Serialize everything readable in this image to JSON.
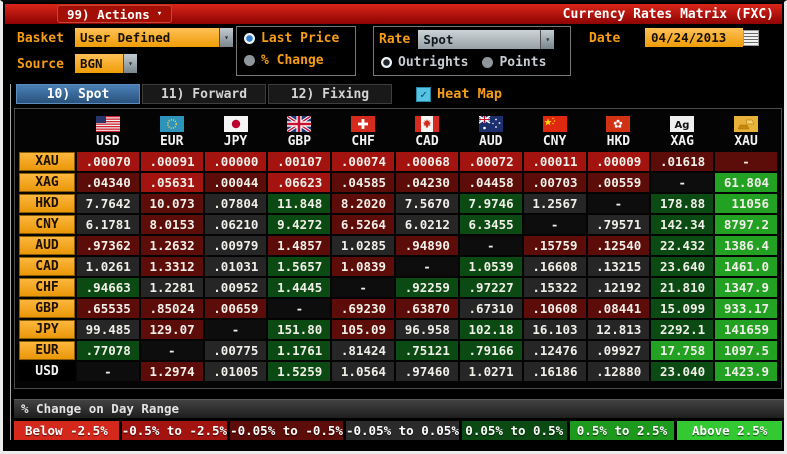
{
  "titlebar": {
    "menu": "99) Actions",
    "title": "Currency Rates Matrix (FXC)"
  },
  "controls": {
    "basket_label": "Basket",
    "basket_value": "User Defined",
    "source_label": "Source",
    "source_value": "BGN",
    "price_mode": [
      {
        "label": "Last Price",
        "selected": true
      },
      {
        "label": "% Change",
        "selected": false
      }
    ],
    "rate_label": "Rate",
    "rate_value": "Spot",
    "rate_mode": [
      {
        "label": "Outrights",
        "selected": true
      },
      {
        "label": "Points",
        "selected": false
      }
    ],
    "date_label": "Date",
    "date_value": "04/24/2013"
  },
  "tabs": [
    {
      "label": "10) Spot",
      "active": true
    },
    {
      "label": "11) Forward",
      "active": false
    },
    {
      "label": "12) Fixing",
      "active": false
    }
  ],
  "heat_map": {
    "label": "Heat Map",
    "checked": true
  },
  "matrix": {
    "columns": [
      {
        "code": "USD",
        "flag": "us"
      },
      {
        "code": "EUR",
        "flag": "eu"
      },
      {
        "code": "JPY",
        "flag": "jp"
      },
      {
        "code": "GBP",
        "flag": "gb"
      },
      {
        "code": "CHF",
        "flag": "ch"
      },
      {
        "code": "CAD",
        "flag": "ca"
      },
      {
        "code": "AUD",
        "flag": "au"
      },
      {
        "code": "CNY",
        "flag": "cn"
      },
      {
        "code": "HKD",
        "flag": "hk"
      },
      {
        "code": "XAG",
        "flag": "ag"
      },
      {
        "code": "XAU",
        "flag": "xau"
      }
    ],
    "rows": [
      {
        "label": "XAU",
        "cells": [
          {
            "v": ".00070",
            "c": "r2"
          },
          {
            "v": ".00091",
            "c": "r2"
          },
          {
            "v": ".00000",
            "c": "r2"
          },
          {
            "v": ".00107",
            "c": "r2"
          },
          {
            "v": ".00074",
            "c": "r2"
          },
          {
            "v": ".00068",
            "c": "r2"
          },
          {
            "v": ".00072",
            "c": "r2"
          },
          {
            "v": ".00011",
            "c": "r2"
          },
          {
            "v": ".00009",
            "c": "r2"
          },
          {
            "v": ".01618",
            "c": "r1"
          },
          {
            "v": "-",
            "c": "r1"
          }
        ]
      },
      {
        "label": "XAG",
        "cells": [
          {
            "v": ".04340",
            "c": "r1"
          },
          {
            "v": ".05631",
            "c": "r2"
          },
          {
            "v": ".00044",
            "c": "r1"
          },
          {
            "v": ".06623",
            "c": "r2"
          },
          {
            "v": ".04585",
            "c": "r1"
          },
          {
            "v": ".04230",
            "c": "r1"
          },
          {
            "v": ".04458",
            "c": "r1"
          },
          {
            "v": ".00703",
            "c": "r1"
          },
          {
            "v": ".00559",
            "c": "r1"
          },
          {
            "v": "-",
            "c": "blk"
          },
          {
            "v": "61.804",
            "c": "g2"
          }
        ]
      },
      {
        "label": "HKD",
        "cells": [
          {
            "v": "7.7642",
            "c": "n0"
          },
          {
            "v": "10.073",
            "c": "r1"
          },
          {
            "v": ".07804",
            "c": "n0"
          },
          {
            "v": "11.848",
            "c": "g1"
          },
          {
            "v": "8.2020",
            "c": "r1"
          },
          {
            "v": "7.5670",
            "c": "n0"
          },
          {
            "v": "7.9746",
            "c": "g1"
          },
          {
            "v": "1.2567",
            "c": "n0"
          },
          {
            "v": "-",
            "c": "blk"
          },
          {
            "v": "178.88",
            "c": "g1"
          },
          {
            "v": "11056",
            "c": "g2"
          }
        ]
      },
      {
        "label": "CNY",
        "cells": [
          {
            "v": "6.1781",
            "c": "n0"
          },
          {
            "v": "8.0153",
            "c": "r1"
          },
          {
            "v": ".06210",
            "c": "n0"
          },
          {
            "v": "9.4272",
            "c": "g1"
          },
          {
            "v": "6.5264",
            "c": "r1"
          },
          {
            "v": "6.0212",
            "c": "n0"
          },
          {
            "v": "6.3455",
            "c": "g1"
          },
          {
            "v": "-",
            "c": "blk"
          },
          {
            "v": ".79571",
            "c": "n0"
          },
          {
            "v": "142.34",
            "c": "g1"
          },
          {
            "v": "8797.2",
            "c": "g2"
          }
        ]
      },
      {
        "label": "AUD",
        "cells": [
          {
            "v": ".97362",
            "c": "r1"
          },
          {
            "v": "1.2632",
            "c": "r1"
          },
          {
            "v": ".00979",
            "c": "n0"
          },
          {
            "v": "1.4857",
            "c": "r1"
          },
          {
            "v": "1.0285",
            "c": "n0"
          },
          {
            "v": ".94890",
            "c": "r1"
          },
          {
            "v": "-",
            "c": "blk"
          },
          {
            "v": ".15759",
            "c": "r1"
          },
          {
            "v": ".12540",
            "c": "r1"
          },
          {
            "v": "22.432",
            "c": "g1"
          },
          {
            "v": "1386.4",
            "c": "g2"
          }
        ]
      },
      {
        "label": "CAD",
        "cells": [
          {
            "v": "1.0261",
            "c": "n0"
          },
          {
            "v": "1.3312",
            "c": "r1"
          },
          {
            "v": ".01031",
            "c": "n0"
          },
          {
            "v": "1.5657",
            "c": "g1"
          },
          {
            "v": "1.0839",
            "c": "r1"
          },
          {
            "v": "-",
            "c": "blk"
          },
          {
            "v": "1.0539",
            "c": "g1"
          },
          {
            "v": ".16608",
            "c": "n0"
          },
          {
            "v": ".13215",
            "c": "n0"
          },
          {
            "v": "23.640",
            "c": "g1"
          },
          {
            "v": "1461.0",
            "c": "g2"
          }
        ]
      },
      {
        "label": "CHF",
        "cells": [
          {
            "v": ".94663",
            "c": "g1"
          },
          {
            "v": "1.2281",
            "c": "n0"
          },
          {
            "v": ".00952",
            "c": "n0"
          },
          {
            "v": "1.4445",
            "c": "g1"
          },
          {
            "v": "-",
            "c": "blk"
          },
          {
            "v": ".92259",
            "c": "g1"
          },
          {
            "v": ".97227",
            "c": "g1"
          },
          {
            "v": ".15322",
            "c": "n0"
          },
          {
            "v": ".12192",
            "c": "n0"
          },
          {
            "v": "21.810",
            "c": "g1"
          },
          {
            "v": "1347.9",
            "c": "g2"
          }
        ]
      },
      {
        "label": "GBP",
        "cells": [
          {
            "v": ".65535",
            "c": "r1"
          },
          {
            "v": ".85024",
            "c": "r1"
          },
          {
            "v": ".00659",
            "c": "r1"
          },
          {
            "v": "-",
            "c": "blk"
          },
          {
            "v": ".69230",
            "c": "r1"
          },
          {
            "v": ".63870",
            "c": "r1"
          },
          {
            "v": ".67310",
            "c": "n0"
          },
          {
            "v": ".10608",
            "c": "r1"
          },
          {
            "v": ".08441",
            "c": "r1"
          },
          {
            "v": "15.099",
            "c": "g1"
          },
          {
            "v": "933.17",
            "c": "g2"
          }
        ]
      },
      {
        "label": "JPY",
        "cells": [
          {
            "v": "99.485",
            "c": "n0"
          },
          {
            "v": "129.07",
            "c": "r1"
          },
          {
            "v": "-",
            "c": "blk"
          },
          {
            "v": "151.80",
            "c": "g1"
          },
          {
            "v": "105.09",
            "c": "r1"
          },
          {
            "v": "96.958",
            "c": "n0"
          },
          {
            "v": "102.18",
            "c": "g1"
          },
          {
            "v": "16.103",
            "c": "n0"
          },
          {
            "v": "12.813",
            "c": "n0"
          },
          {
            "v": "2292.1",
            "c": "g1"
          },
          {
            "v": "141659",
            "c": "g2"
          }
        ]
      },
      {
        "label": "EUR",
        "cells": [
          {
            "v": ".77078",
            "c": "g1"
          },
          {
            "v": "-",
            "c": "blk"
          },
          {
            "v": ".00775",
            "c": "n0"
          },
          {
            "v": "1.1761",
            "c": "g1"
          },
          {
            "v": ".81424",
            "c": "n0"
          },
          {
            "v": ".75121",
            "c": "g1"
          },
          {
            "v": ".79166",
            "c": "g1"
          },
          {
            "v": ".12476",
            "c": "n0"
          },
          {
            "v": ".09927",
            "c": "n0"
          },
          {
            "v": "17.758",
            "c": "g2"
          },
          {
            "v": "1097.5",
            "c": "g2"
          }
        ]
      },
      {
        "label": "USD",
        "header_style": "plain",
        "cells": [
          {
            "v": "-",
            "c": "blk"
          },
          {
            "v": "1.2974",
            "c": "r1"
          },
          {
            "v": ".01005",
            "c": "n0"
          },
          {
            "v": "1.5259",
            "c": "g1"
          },
          {
            "v": "1.0564",
            "c": "n0"
          },
          {
            "v": ".97460",
            "c": "n0"
          },
          {
            "v": "1.0271",
            "c": "n0"
          },
          {
            "v": ".16186",
            "c": "n0"
          },
          {
            "v": ".12880",
            "c": "n0"
          },
          {
            "v": "23.040",
            "c": "g1"
          },
          {
            "v": "1423.9",
            "c": "g2"
          }
        ]
      }
    ]
  },
  "heat_colors": {
    "r2": "#a31411",
    "r1": "#5c0c09",
    "n0": "#262626",
    "blk": "#0d0d0d",
    "g1": "#0b4a12",
    "g2": "#23a123"
  },
  "legend": {
    "title": "% Change on Day Range",
    "items": [
      {
        "label": "Below -2.5%",
        "color": "#d5281c"
      },
      {
        "label": "-0.5% to -2.5%",
        "color": "#a31411"
      },
      {
        "label": "-0.05% to -0.5%",
        "color": "#5c0c09"
      },
      {
        "label": "-0.05% to 0.05%",
        "color": "#2b2b2b"
      },
      {
        "label": "0.05% to 0.5%",
        "color": "#0b4a12"
      },
      {
        "label": "0.5% to 2.5%",
        "color": "#1d9a1d"
      },
      {
        "label": "Above 2.5%",
        "color": "#32c932"
      }
    ]
  }
}
